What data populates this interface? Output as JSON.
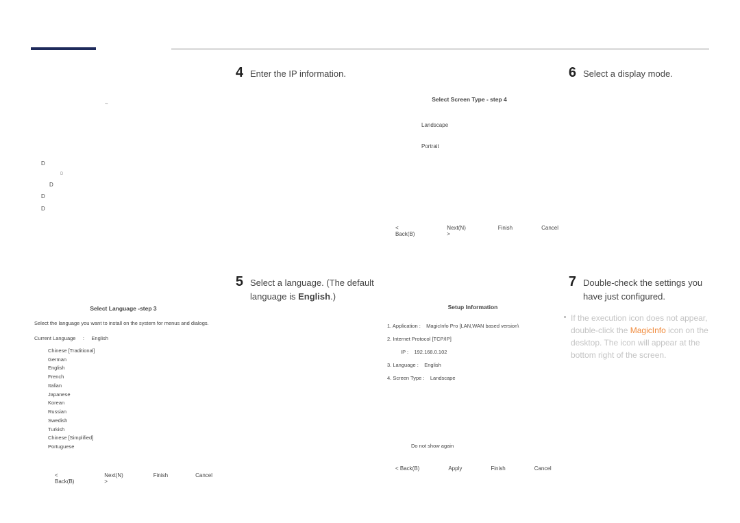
{
  "steps": {
    "s4": {
      "num": "4",
      "text": "Enter the IP information."
    },
    "s5": {
      "num": "5",
      "text_a": "Select a language. (The default language is ",
      "text_bold": "English",
      "text_c": ".)"
    },
    "s6": {
      "num": "6",
      "text": "Select a display mode."
    },
    "s7": {
      "num": "7",
      "text": "Double-check the settings you have just configured."
    }
  },
  "left_art": {
    "tilde": "~",
    "d1": "D",
    "d2": "D",
    "d3": "D",
    "d4": "D",
    "d5": "D"
  },
  "lang": {
    "title": "Select Language -step 3",
    "desc": "Select the language you want to install on the system for menus and dialogs.",
    "current_label": "Current Language",
    "current_sep": ":",
    "current_value": "English",
    "items": [
      "Chinese [Traditional]",
      "German",
      "English",
      "French",
      "Italian",
      "Japanese",
      "Korean",
      "Russian",
      "Swedish",
      "Turkish",
      "Chinese [Simplified]",
      "Portuguese"
    ],
    "btn_back": "< Back(B)",
    "btn_next": "Next(N) >",
    "btn_finish": "Finish",
    "btn_cancel": "Cancel"
  },
  "screen": {
    "title": "Select Screen Type - step 4",
    "opt1": "Landscape",
    "opt2": "Portrait",
    "btn_back": "< Back(B)",
    "btn_next": "Next(N) >",
    "btn_finish": "Finish",
    "btn_cancel": "Cancel"
  },
  "info": {
    "title": "Setup Information",
    "r1a": "1. Application :",
    "r1b": "MagicInfo Pro [LAN,WAN based version\\",
    "r2": "2. Internet Protocol [TCP/IP]",
    "ip_label": "IP :",
    "ip_value": "192.168.0.102",
    "r3a": "3. Language :",
    "r3b": "English",
    "r4a": "4. Screen Type :",
    "r4b": "Landscape",
    "chk": "Do not show again",
    "btn_back": "< Back(B)",
    "btn_apply": "Apply",
    "btn_finish": "Finish",
    "btn_cancel": "Cancel"
  },
  "note": {
    "t1": "If the execution icon does not appear, double-click the ",
    "mi": "MagicInfo",
    "t2": " icon on the desktop. The icon will appear at the bottom right of the screen."
  }
}
